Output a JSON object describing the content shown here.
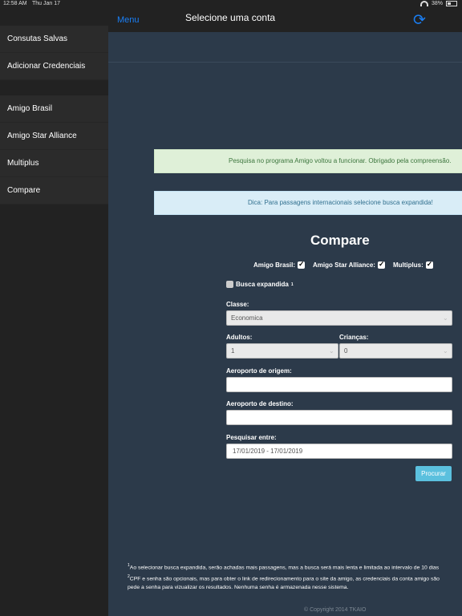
{
  "status": {
    "time": "12:58 AM",
    "date": "Thu Jan 17",
    "battery": "38%"
  },
  "nav": {
    "menu_label": "Menu",
    "sync_icon": "sync-icon"
  },
  "sidebar": {
    "group1": [
      {
        "label": "Consutas Salvas"
      },
      {
        "label": "Adicionar Credenciais"
      }
    ],
    "group2": [
      {
        "label": "Amigo Brasil"
      },
      {
        "label": "Amigo Star Alliance"
      },
      {
        "label": "Multiplus"
      },
      {
        "label": "Compare"
      }
    ]
  },
  "header": {
    "title": "Selecione uma conta"
  },
  "alerts": {
    "success": "Pesquisa no programa Amigo voltou a funcionar. Obrigado pela compreensão.",
    "info": "Dica: Para passagens internacionais selecione busca expandida!"
  },
  "compare": {
    "title": "Compare",
    "programs": [
      {
        "label": "Amigo Brasil:",
        "checked": true
      },
      {
        "label": "Amigo Star Alliance:",
        "checked": true
      },
      {
        "label": "Multiplus:",
        "checked": true
      }
    ],
    "expanded_label": "Busca expandida",
    "expanded_sup": "1",
    "expanded_checked": false,
    "class_label": "Classe:",
    "class_value": "Economica",
    "adults_label": "Adultos:",
    "adults_value": "1",
    "children_label": "Crianças:",
    "children_value": "0",
    "origin_label": "Aeroporto de origem:",
    "origin_value": "",
    "destination_label": "Aeroporto de destino:",
    "destination_value": "",
    "dates_label": "Pesquisar entre:",
    "dates_value": "17/01/2019 - 17/01/2019",
    "search_button": "Procurar"
  },
  "footnotes": {
    "note1_sup": "1",
    "note1": "Ao selecionar busca expandida, serão achadas mais passagens, mas a busca será mais lenta e limitada ao intervalo de 10 dias",
    "note2_sup": "2",
    "note2": "CPF e senha são opcionais, mas para obter o link de redirecionamento para o site da amigo, as credenciais da conta amigo são",
    "note2_cont": "pede a senha para vizualizar os resultados. Nenhuma senha é armazenada nesse sistema."
  },
  "copyright": "© Copyright 2014 TKAIO"
}
